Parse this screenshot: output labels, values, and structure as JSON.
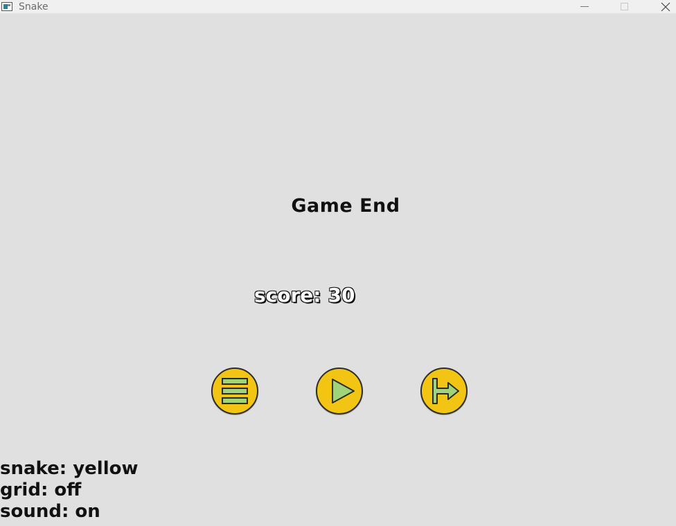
{
  "window": {
    "title": "Snake"
  },
  "game": {
    "title": "Game End",
    "score_label": "score:",
    "score_value": "30"
  },
  "buttons": {
    "menu_icon": "menu-icon",
    "play_icon": "play-icon",
    "exit_icon": "exit-icon",
    "fill_color": "#f2c414",
    "icon_color": "#9fd47a"
  },
  "settings": {
    "snake": "snake: yellow",
    "grid": "grid: off",
    "sound": "sound: on"
  }
}
